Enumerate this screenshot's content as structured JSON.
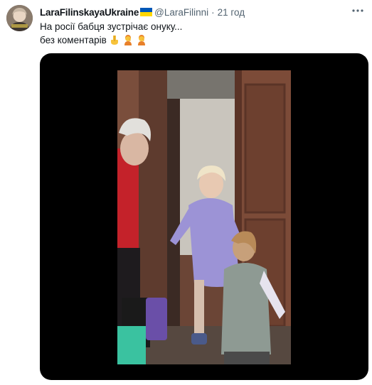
{
  "tweet": {
    "display_name": "LaraFilinskayaUkraine",
    "handle": "@LaraFilinni",
    "separator": "·",
    "time": "21 год",
    "text_line1": "На росії бабця зустрічає онуку...",
    "text_line2": "без коментарів",
    "emojis": [
      "point-down-emoji",
      "facepalm-woman-emoji",
      "facepalm-woman-emoji"
    ],
    "more_icon": "more-horizontal-icon"
  },
  "media": {
    "type": "video",
    "background": "#000000"
  },
  "colors": {
    "text": "#0f1419",
    "secondary": "#536471",
    "flag_blue": "#0057b7",
    "flag_yellow": "#ffd700"
  }
}
